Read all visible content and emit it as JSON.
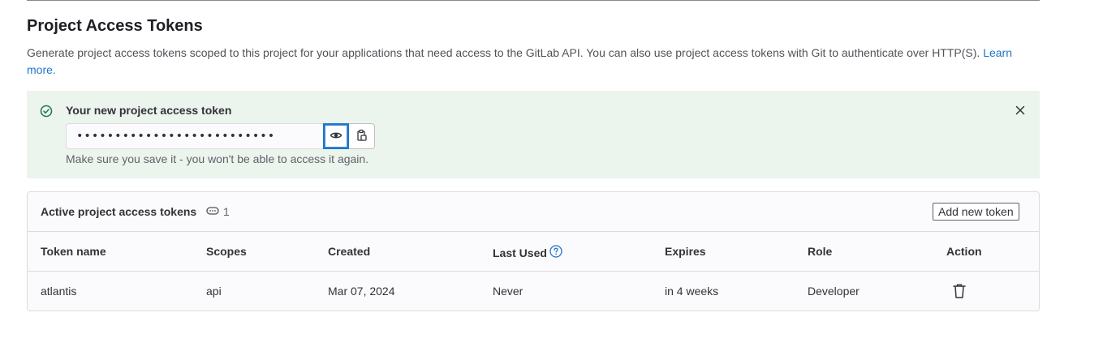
{
  "section": {
    "title": "Project Access Tokens",
    "description": "Generate project access tokens scoped to this project for your applications that need access to the GitLab API. You can also use project access tokens with Git to authenticate over HTTP(S).",
    "learn_more": "Learn more."
  },
  "alert": {
    "title": "Your new project access token",
    "token_masked": "••••••••••••••••••••••••••",
    "help": "Make sure you save it - you won't be able to access it again.",
    "icons": {
      "status": "check-circle-icon",
      "close": "close-icon",
      "reveal": "eye-icon",
      "copy": "copy-to-clipboard-icon"
    },
    "colors": {
      "background": "#ecf4ee",
      "success": "#217645"
    }
  },
  "tokens_card": {
    "title": "Active project access tokens",
    "count": "1",
    "count_icon": "token-icon",
    "add_button": "Add new token",
    "columns": [
      "Token name",
      "Scopes",
      "Created",
      "Last Used",
      "Expires",
      "Role",
      "Action"
    ],
    "last_used_help_icon": "question-circle-icon",
    "rows": [
      {
        "name": "atlantis",
        "scopes": "api",
        "created": "Mar 07, 2024",
        "last_used": "Never",
        "expires": "in 4 weeks",
        "role": "Developer",
        "action_icon": "trash-icon"
      }
    ]
  }
}
